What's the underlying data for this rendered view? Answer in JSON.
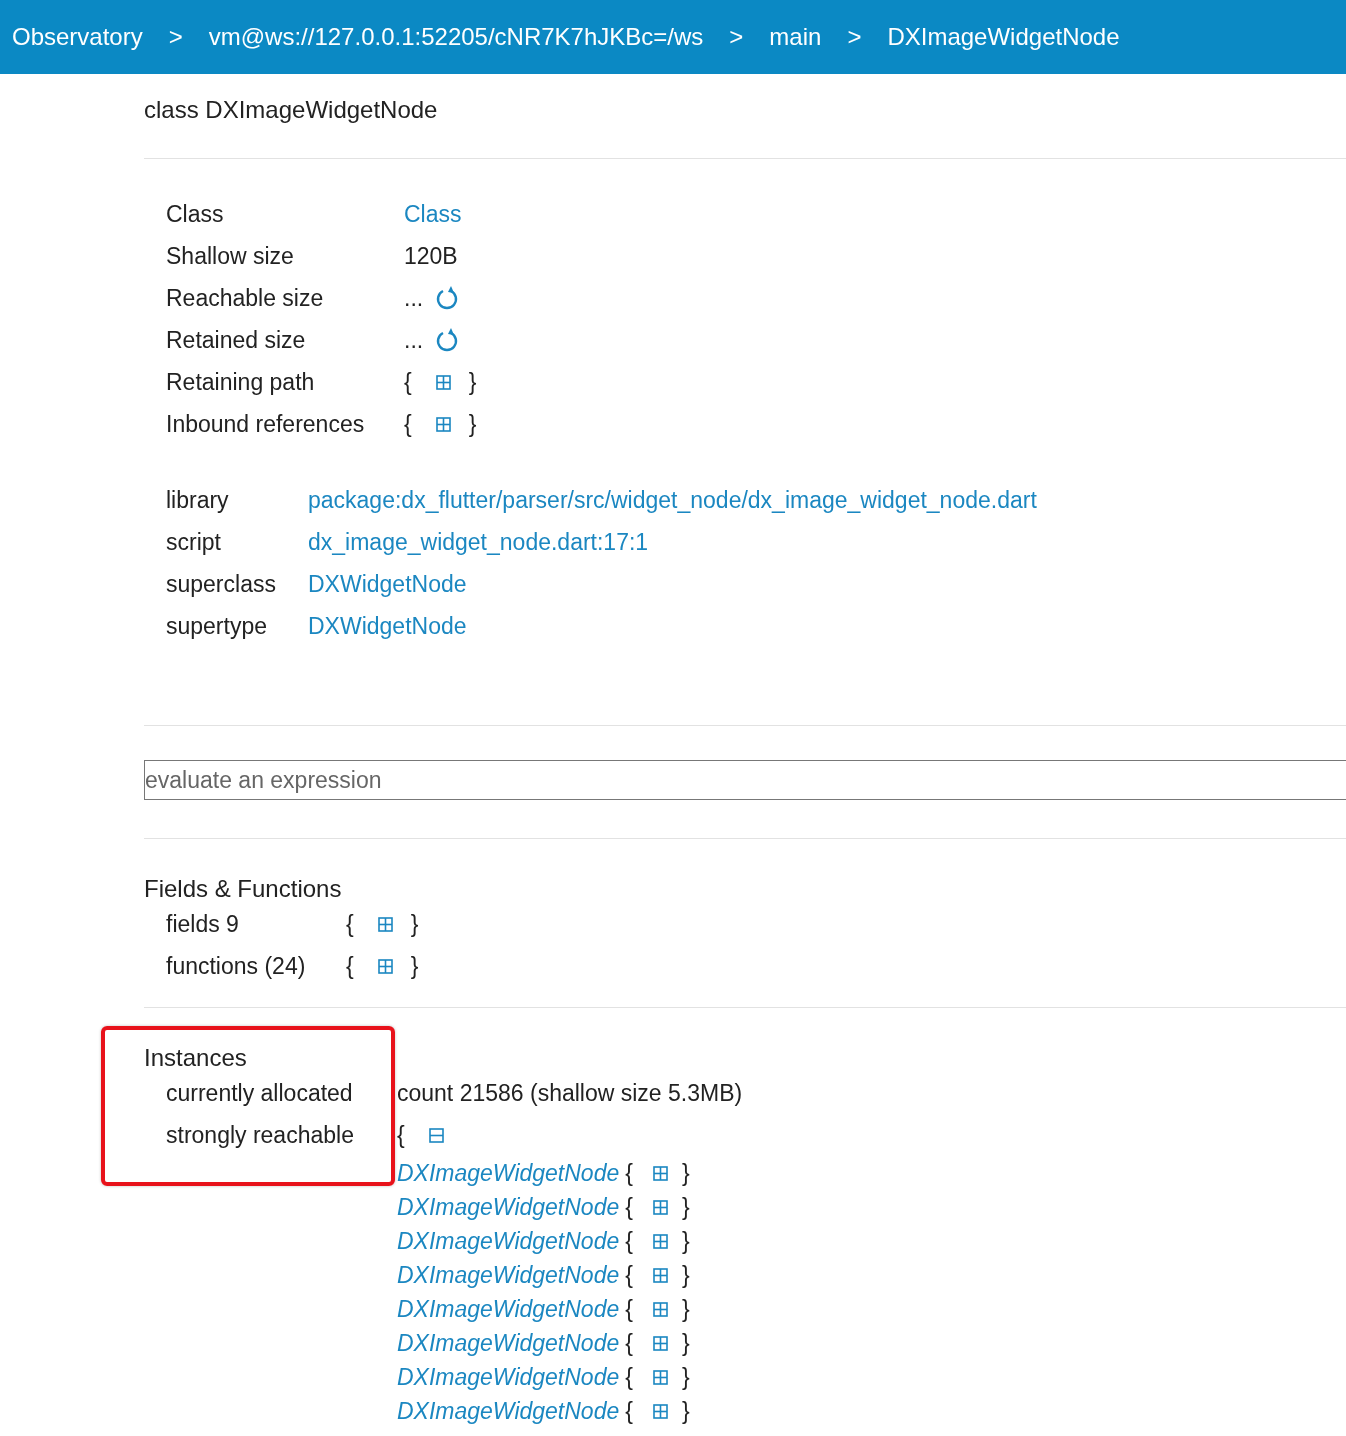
{
  "breadcrumbs": [
    {
      "label": "Observatory"
    },
    {
      "separator": ">",
      "label": "vm@ws://127.0.0.1:52205/cNR7K7hJKBc=/ws"
    },
    {
      "separator": ">",
      "label": "main"
    },
    {
      "separator": ">",
      "label": "DXImageWidgetNode"
    }
  ],
  "title": "class DXImageWidgetNode",
  "properties": [
    {
      "label": "Class",
      "kind": "link",
      "value": "Class"
    },
    {
      "label": "Shallow size",
      "kind": "text",
      "value": "120B"
    },
    {
      "label": "Reachable size",
      "kind": "refresh",
      "value": "..."
    },
    {
      "label": "Retained size",
      "kind": "refresh",
      "value": "..."
    },
    {
      "label": "Retaining path",
      "kind": "expand",
      "open": "{",
      "close": "}",
      "expanded": false
    },
    {
      "label": "Inbound references",
      "kind": "expand",
      "open": "{",
      "close": "}",
      "expanded": false
    }
  ],
  "details": [
    {
      "label": "library",
      "value": "package:dx_flutter/parser/src/widget_node/dx_image_widget_node.dart"
    },
    {
      "label": "script",
      "value": "dx_image_widget_node.dart:17:1"
    },
    {
      "label": "superclass",
      "value": "DXWidgetNode"
    },
    {
      "label": "supertype",
      "value": "DXWidgetNode"
    }
  ],
  "evaluate": {
    "placeholder": "evaluate an expression"
  },
  "fields_functions": {
    "heading": "Fields & Functions",
    "rows": [
      {
        "label": "fields 9",
        "open": "{",
        "close": "}",
        "expanded": false
      },
      {
        "label": "functions (24)",
        "open": "{",
        "close": "}",
        "expanded": false
      }
    ]
  },
  "instances": {
    "heading": "Instances",
    "highlighted": true,
    "allocated": {
      "label": "currently allocated",
      "value": "count 21586 (shallow size 5.3MB)"
    },
    "reachable": {
      "label": "strongly reachable",
      "open": "{",
      "expanded": true,
      "items": [
        {
          "label": "DXImageWidgetNode",
          "open": "{",
          "close": "}",
          "expanded": false
        },
        {
          "label": "DXImageWidgetNode",
          "open": "{",
          "close": "}",
          "expanded": false
        },
        {
          "label": "DXImageWidgetNode",
          "open": "{",
          "close": "}",
          "expanded": false
        },
        {
          "label": "DXImageWidgetNode",
          "open": "{",
          "close": "}",
          "expanded": false
        },
        {
          "label": "DXImageWidgetNode",
          "open": "{",
          "close": "}",
          "expanded": false
        },
        {
          "label": "DXImageWidgetNode",
          "open": "{",
          "close": "}",
          "expanded": false
        },
        {
          "label": "DXImageWidgetNode",
          "open": "{",
          "close": "}",
          "expanded": false
        },
        {
          "label": "DXImageWidgetNode",
          "open": "{",
          "close": "}",
          "expanded": false
        }
      ]
    }
  }
}
